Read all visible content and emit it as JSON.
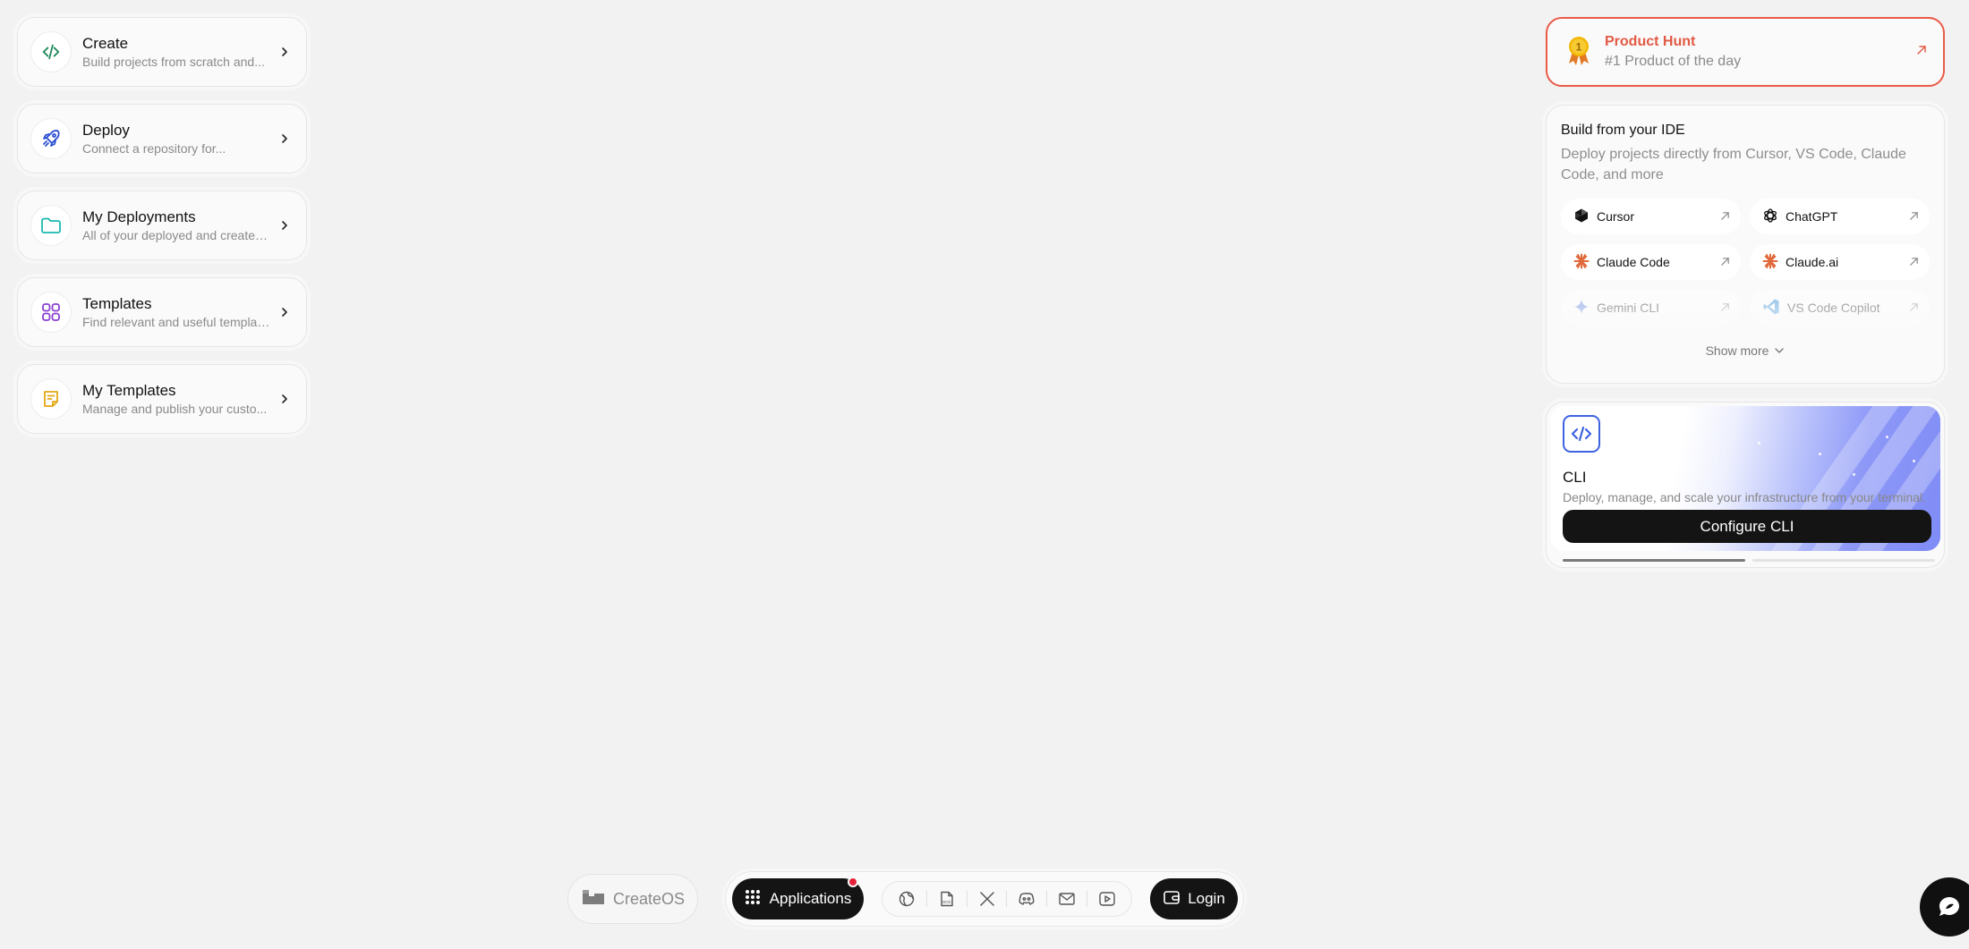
{
  "nav": {
    "items": [
      {
        "icon": "code-icon",
        "title": "Create",
        "subtitle": "Build projects from scratch and..."
      },
      {
        "icon": "rocket-icon",
        "title": "Deploy",
        "subtitle": "Connect a repository for..."
      },
      {
        "icon": "folder-icon",
        "title": "My Deployments",
        "subtitle": "All of your deployed and created..."
      },
      {
        "icon": "grid-icon",
        "title": "Templates",
        "subtitle": "Find relevant and useful templat..."
      },
      {
        "icon": "note-icon",
        "title": "My Templates",
        "subtitle": "Manage and publish your custo..."
      }
    ]
  },
  "product_hunt": {
    "title": "Product Hunt",
    "subtitle": "#1 Product of the day",
    "badge_number": "1",
    "accent": "#e25a45"
  },
  "ide": {
    "title": "Build from your IDE",
    "subtitle": "Deploy projects directly from Cursor, VS Code, Claude Code, and more",
    "tools": [
      {
        "name": "Cursor",
        "icon": "cursor-icon"
      },
      {
        "name": "ChatGPT",
        "icon": "chatgpt-icon"
      },
      {
        "name": "Claude Code",
        "icon": "claude-icon"
      },
      {
        "name": "Claude.ai",
        "icon": "claude-icon"
      },
      {
        "name": "Gemini CLI",
        "icon": "gemini-icon"
      },
      {
        "name": "VS Code Copilot",
        "icon": "vscode-icon"
      }
    ],
    "show_more": "Show more"
  },
  "cli": {
    "title": "CLI",
    "subtitle": "Deploy, manage, and scale your infrastructure from your terminal.",
    "button": "Configure CLI",
    "icon": "code-icon"
  },
  "dock": {
    "brand": "CreateOS",
    "applications": "Applications",
    "socials": [
      "globe-icon",
      "docs-icon",
      "x-icon",
      "discord-icon",
      "mail-icon",
      "youtube-icon"
    ],
    "login": "Login",
    "notification_color": "#e5223a"
  },
  "colors": {
    "background": "#f2f2f2",
    "dark": "#141414",
    "cli_accent": "#3d63e0"
  }
}
